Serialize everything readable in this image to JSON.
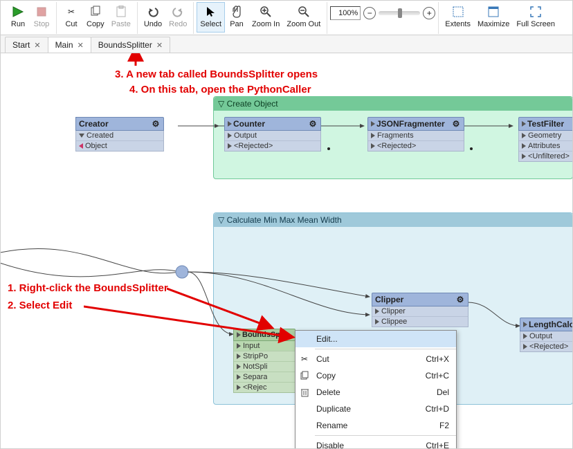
{
  "toolbar": {
    "run": "Run",
    "stop": "Stop",
    "cut": "Cut",
    "copy": "Copy",
    "paste": "Paste",
    "undo": "Undo",
    "redo": "Redo",
    "select": "Select",
    "pan": "Pan",
    "zoom_in": "Zoom In",
    "zoom_out": "Zoom Out",
    "zoom_pct": "100%",
    "extents": "Extents",
    "maximize": "Maximize",
    "full_screen": "Full Screen"
  },
  "tabs": {
    "t0": "Start",
    "t1": "Main",
    "t2": "BoundsSplitter"
  },
  "groups": {
    "g1": "Create Object",
    "g2": "Calculate Min Max Mean Width"
  },
  "nodes": {
    "creator": {
      "title": "Creator",
      "p0": "Created",
      "p1": "Object"
    },
    "counter": {
      "title": "Counter",
      "p0": "Output",
      "p1": "<Rejected>"
    },
    "json": {
      "title": "JSONFragmenter",
      "p0": "Fragments",
      "p1": "<Rejected>"
    },
    "testfilter": {
      "title": "TestFilter",
      "p0": "Geometry",
      "p1": "Attributes",
      "p2": "<Unfiltered>"
    },
    "clipper": {
      "title": "Clipper",
      "p0": "Clipper",
      "p1": "Clippee"
    },
    "lengthcalc": {
      "title": "LengthCalculator",
      "p0": "Output",
      "p1": "<Rejected>"
    },
    "bounds": {
      "title": "BoundsSplitter",
      "p_in": "Input",
      "p0": "StripPolygon",
      "p1": "NotSplit",
      "p2": "Separated",
      "p3": "<Rejected>"
    }
  },
  "ctxmenu": {
    "edit": "Edit...",
    "cut": "Cut",
    "cut_k": "Ctrl+X",
    "copy": "Copy",
    "copy_k": "Ctrl+C",
    "delete": "Delete",
    "delete_k": "Del",
    "duplicate": "Duplicate",
    "duplicate_k": "Ctrl+D",
    "rename": "Rename",
    "rename_k": "F2",
    "disable": "Disable",
    "disable_k": "Ctrl+E"
  },
  "annotations": {
    "a1": "1. Right-click the BoundsSplitter",
    "a2": "2. Select Edit",
    "a3": "3. A new tab called BoundsSplitter opens",
    "a4": "4. On this tab, open the PythonCaller"
  }
}
